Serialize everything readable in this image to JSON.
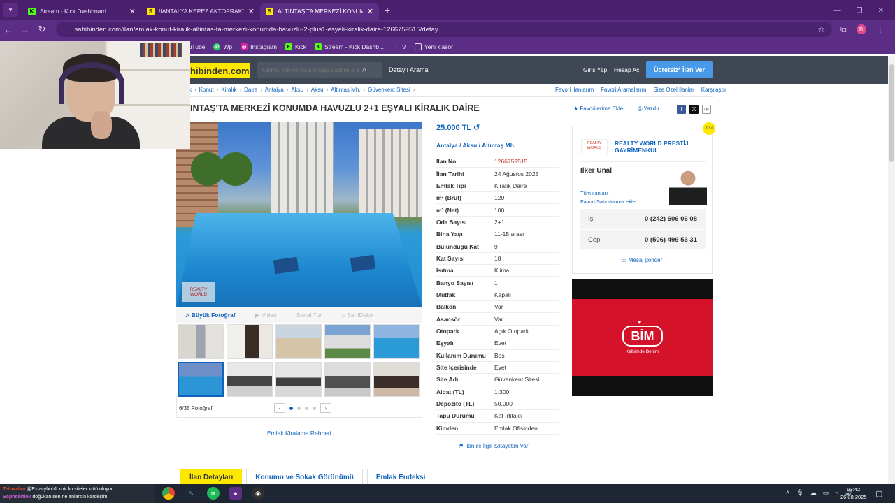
{
  "browser": {
    "tabs": [
      {
        "title": "Stream - Kick Dashboard",
        "favicon": "K"
      },
      {
        "title": "!IANTALYA KEPEZ AKTOPRAK'TA",
        "favicon": "S"
      },
      {
        "title": "ALTINTAŞ'TA MERKEZİ KONUM",
        "favicon": "S"
      }
    ],
    "url": "sahibinden.com/ilan/emlak-konut-kiralik-altintas-ta-merkezi-konumda-havuzlu-2-plus1-esyali-kiralik-daire-1266759515/detay",
    "profile_initial": "B",
    "bookmarks": [
      "YouTube",
      "Wp",
      "Instagram",
      "Kick",
      "Stream - Kick Dashb...",
      "V",
      "Yeni klasör"
    ]
  },
  "site": {
    "logo": "hibinden.com",
    "search_placeholder": "Kelime, ilan no veya mağaza adı ile ara",
    "advanced_search": "Detaylı Arama",
    "login": "Giriş Yap",
    "signup": "Hesap Aç",
    "post_ad": "Ücretsiz* İlan Ver",
    "breadcrumb": [
      "k",
      "Konut",
      "Kiralık",
      "Daire",
      "Antalya",
      "Aksu",
      "Aksu",
      "Altıntaş Mh.",
      "Güvenkent Sitesi"
    ],
    "quick_links": [
      "Favori İlanlarım",
      "Favori Aramalarım",
      "Size Özel İlanlar",
      "Karşılaştır"
    ]
  },
  "listing": {
    "title": "INTAŞ'TA MERKEZİ KONUMDA HAVUZLU 2+1 EŞYALI KİRALIK DAİRE",
    "add_favorite": "Favorilerime Ekle",
    "print": "Yazdır",
    "price": "25.000 TL",
    "location": [
      "Antalya",
      "Aksu",
      "Altıntaş Mh."
    ],
    "photo_watermark": "REALTY WORLD",
    "photo_tools": [
      "Büyük Fotoğraf",
      "Video",
      "Sanal Tur",
      "SahiDeko"
    ],
    "photo_count": "6/35 Fotoğraf",
    "guide_link": "Emlak Kiralama Rehberi",
    "details": [
      {
        "key": "İlan No",
        "value": "1266759515",
        "highlight": true
      },
      {
        "key": "İlan Tarihi",
        "value": "24 Ağustos 2025"
      },
      {
        "key": "Emlak Tipi",
        "value": "Kiralık Daire"
      },
      {
        "key": "m² (Brüt)",
        "value": "120"
      },
      {
        "key": "m² (Net)",
        "value": "100"
      },
      {
        "key": "Oda Sayısı",
        "value": "2+1"
      },
      {
        "key": "Bina Yaşı",
        "value": "11-15 arası"
      },
      {
        "key": "Bulunduğu Kat",
        "value": "9"
      },
      {
        "key": "Kat Sayısı",
        "value": "18"
      },
      {
        "key": "Isıtma",
        "value": "Klima"
      },
      {
        "key": "Banyo Sayısı",
        "value": "1"
      },
      {
        "key": "Mutfak",
        "value": "Kapalı"
      },
      {
        "key": "Balkon",
        "value": "Var"
      },
      {
        "key": "Asansör",
        "value": "Var"
      },
      {
        "key": "Otopark",
        "value": "Açık Otopark"
      },
      {
        "key": "Eşyalı",
        "value": "Evet"
      },
      {
        "key": "Kullanım Durumu",
        "value": "Boş"
      },
      {
        "key": "Site İçerisinde",
        "value": "Evet"
      },
      {
        "key": "Site Adı",
        "value": "Güvenkent Sitesi"
      },
      {
        "key": "Aidat (TL)",
        "value": "1.300"
      },
      {
        "key": "Depozito (TL)",
        "value": "50.000"
      },
      {
        "key": "Tapu Durumu",
        "value": "Kat İrtifaklı"
      },
      {
        "key": "Kimden",
        "value": "Emlak Ofisinden"
      }
    ],
    "complaint": "İlan ile İlgili Şikayetim Var"
  },
  "seller": {
    "badge": "3 Yıl",
    "agency_logo": "REALTY WORLD",
    "agency_name": "REALTY WORLD PRESTİJ GAYRİMENKUL",
    "agent_name": "Ilker Unal",
    "all_listings": "Tüm ilanları",
    "add_fav_seller": "Favori Satıcılarıma ekle",
    "phones": [
      {
        "label": "İş",
        "number": "0 (242) 606 06 08"
      },
      {
        "label": "Cep",
        "number": "0 (506) 499 53 31"
      }
    ],
    "message": "Mesaj gönder"
  },
  "ad": {
    "brand": "BİM",
    "slogan": "Kalbimde Benim"
  },
  "bottom_tabs": [
    "İlan Detayları",
    "Konumu ve Sokak Görünümü",
    "Emlak Endeksi"
  ],
  "chat": [
    {
      "user": "Tetovalım",
      "text": "@Extacybob1 knk bu siteler kötü oluyor"
    },
    {
      "user": "Sophobitlox",
      "text": "doğukan sen ne anlarsın kardeşim"
    }
  ],
  "taskbar": {
    "time": "03:42",
    "date": "26.08.2025"
  }
}
